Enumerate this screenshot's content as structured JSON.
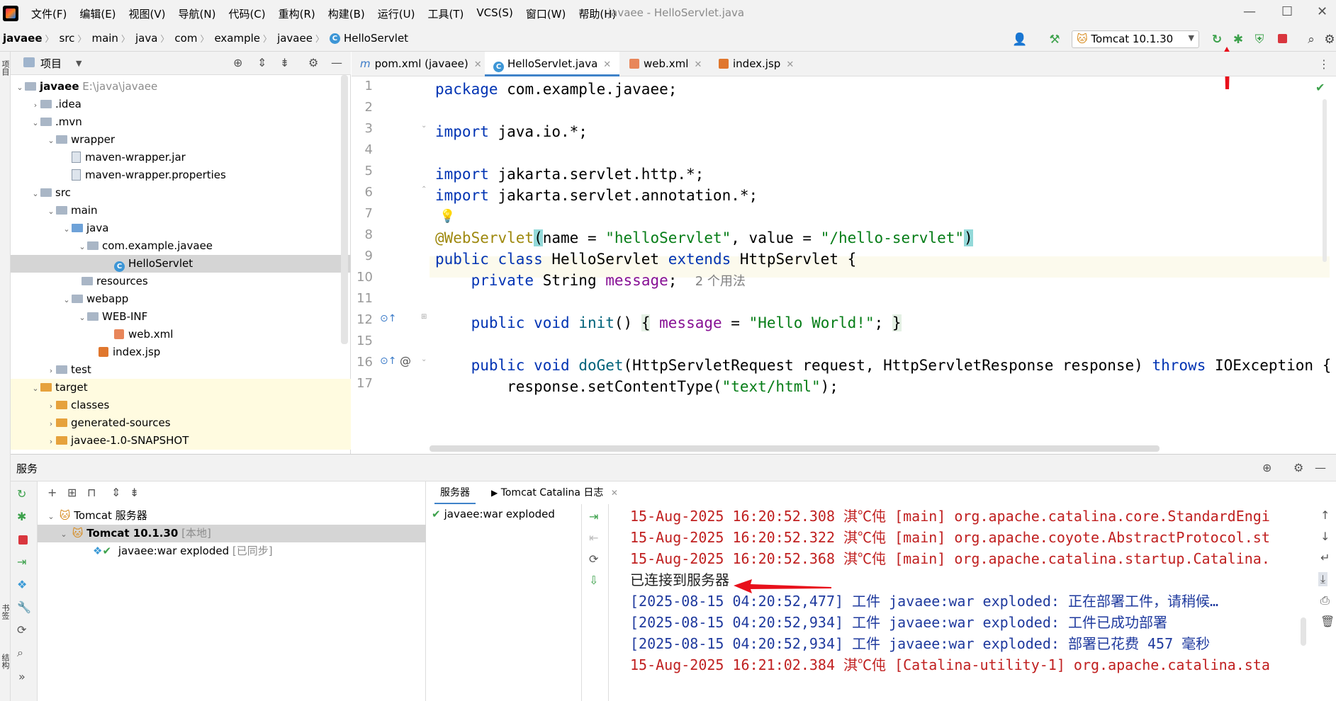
{
  "menubar": {
    "items": [
      "文件(F)",
      "编辑(E)",
      "视图(V)",
      "导航(N)",
      "代码(C)",
      "重构(R)",
      "构建(B)",
      "运行(U)",
      "工具(T)",
      "VCS(S)",
      "窗口(W)",
      "帮助(H)"
    ],
    "window_title": "javaee - HelloServlet.java"
  },
  "navbar": {
    "breadcrumbs": [
      "javaee",
      "src",
      "main",
      "java",
      "com",
      "example",
      "javaee",
      "HelloServlet"
    ],
    "run_config": "Tomcat 10.1.30"
  },
  "left_strip": {
    "project_tab": "项目",
    "bookmarks_tab": "书签",
    "structure_tab": "结构"
  },
  "project": {
    "title": "项目",
    "tree": [
      {
        "label": "javaee",
        "note": "E:\\java\\javaee",
        "depth": 0,
        "icon": "folder",
        "expanded": true
      },
      {
        "label": ".idea",
        "depth": 1,
        "icon": "folder",
        "expanded": false
      },
      {
        "label": ".mvn",
        "depth": 1,
        "icon": "folder",
        "expanded": true
      },
      {
        "label": "wrapper",
        "depth": 2,
        "icon": "folder",
        "expanded": true
      },
      {
        "label": "maven-wrapper.jar",
        "depth": 3,
        "icon": "file"
      },
      {
        "label": "maven-wrapper.properties",
        "depth": 3,
        "icon": "file"
      },
      {
        "label": "src",
        "depth": 1,
        "icon": "folder",
        "expanded": true
      },
      {
        "label": "main",
        "depth": 2,
        "icon": "folder",
        "expanded": true
      },
      {
        "label": "java",
        "depth": 3,
        "icon": "folder-blue",
        "expanded": true
      },
      {
        "label": "com.example.javaee",
        "depth": 4,
        "icon": "package",
        "expanded": true
      },
      {
        "label": "HelloServlet",
        "depth": 5,
        "icon": "class",
        "selected": true
      },
      {
        "label": "resources",
        "depth": 3,
        "icon": "folder-res"
      },
      {
        "label": "webapp",
        "depth": 3,
        "icon": "folder",
        "expanded": true
      },
      {
        "label": "WEB-INF",
        "depth": 4,
        "icon": "folder",
        "expanded": true
      },
      {
        "label": "web.xml",
        "depth": 5,
        "icon": "xml"
      },
      {
        "label": "index.jsp",
        "depth": 4,
        "icon": "jsp"
      },
      {
        "label": "test",
        "depth": 2,
        "icon": "folder",
        "expanded": false
      },
      {
        "label": "target",
        "depth": 1,
        "icon": "folder-orange",
        "expanded": true,
        "excluded": true
      },
      {
        "label": "classes",
        "depth": 2,
        "icon": "folder-orange",
        "expanded": false,
        "excluded": true
      },
      {
        "label": "generated-sources",
        "depth": 2,
        "icon": "folder-orange",
        "expanded": false,
        "excluded": true
      },
      {
        "label": "javaee-1.0-SNAPSHOT",
        "depth": 2,
        "icon": "folder-orange",
        "expanded": false,
        "excluded": true
      }
    ]
  },
  "editor": {
    "tabs": [
      {
        "label": "pom.xml (javaee)",
        "icon": "m"
      },
      {
        "label": "HelloServlet.java",
        "icon": "class",
        "active": true
      },
      {
        "label": "web.xml",
        "icon": "xml"
      },
      {
        "label": "index.jsp",
        "icon": "jsp"
      }
    ],
    "line_numbers": [
      "1",
      "2",
      "3",
      "4",
      "5",
      "6",
      "7",
      "8",
      "9",
      "10",
      "11",
      "12",
      "15",
      "16",
      "17"
    ],
    "hint_usages": "2 个用法"
  },
  "services": {
    "title": "服务",
    "tree": {
      "root": "Tomcat 服务器",
      "server": "Tomcat 10.1.30",
      "server_tag": "[本地]",
      "artifact": "javaee:war exploded",
      "artifact_tag": "[已同步]"
    },
    "tabs": [
      "服务器",
      "Tomcat Catalina 日志"
    ],
    "deployment": "javaee:war exploded",
    "log": [
      {
        "text": "15-Aug-2025 16:20:52.308 淇℃伅 [main] org.apache.catalina.core.StandardEngi",
        "color": "red"
      },
      {
        "text": "15-Aug-2025 16:20:52.322 淇℃伅 [main] org.apache.coyote.AbstractProtocol.st",
        "color": "red"
      },
      {
        "text": "15-Aug-2025 16:20:52.368 淇℃伅 [main] org.apache.catalina.startup.Catalina.",
        "color": "red"
      },
      {
        "text": "已连接到服务器",
        "color": "black"
      },
      {
        "text": "[2025-08-15 04:20:52,477] 工件 javaee:war exploded: 正在部署工件，请稍候…",
        "color": "blue"
      },
      {
        "text": "[2025-08-15 04:20:52,934] 工件 javaee:war exploded: 工件已成功部署",
        "color": "blue"
      },
      {
        "text": "[2025-08-15 04:20:52,934] 工件 javaee:war exploded: 部署已花费 457 毫秒",
        "color": "blue"
      },
      {
        "text": "15-Aug-2025 16:21:02.384 淇℃伅 [Catalina-utility-1] org.apache.catalina.sta",
        "color": "red"
      }
    ]
  },
  "colors": {
    "accent": "#4083c9",
    "log_red": "#c02020",
    "log_blue": "#1f3a9e",
    "annotation_arrow": "#e8101b"
  }
}
